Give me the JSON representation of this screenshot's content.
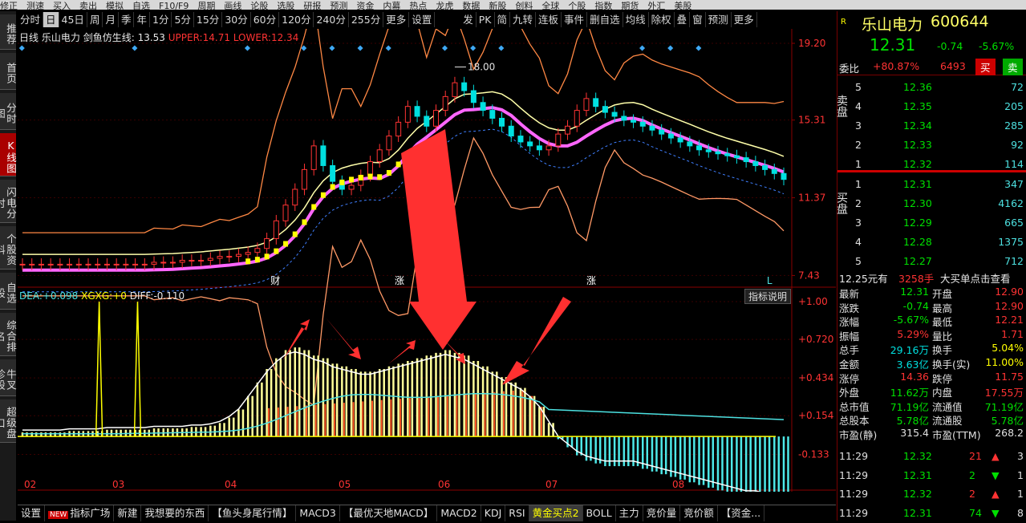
{
  "top_menu": [
    "修正",
    "测速",
    "买入",
    "卖出",
    "模拟",
    "自选",
    "F10/F9",
    "周期",
    "画线",
    "论股",
    "选股",
    "研报",
    "预测",
    "资金",
    "内幕",
    "热点",
    "龙虎",
    "数据",
    "新股",
    "创料",
    "全球",
    "个股",
    "指数",
    "期货",
    "外汇",
    "美股"
  ],
  "period_bar": {
    "items": [
      "分时",
      "日",
      "45日",
      "周",
      "月",
      "季",
      "年",
      "1分",
      "5分",
      "15分",
      "30分",
      "60分",
      "120分",
      "240分",
      "255分",
      "更多",
      "设置"
    ],
    "active": "日",
    "right_items": [
      "发",
      "PK",
      "简",
      "九转",
      "连板",
      "事件",
      "删自选",
      "均线",
      "除权",
      "叠",
      "窗",
      "预测",
      "更多"
    ]
  },
  "left_nav": [
    "推荐",
    "首页",
    "分时图",
    "K线图",
    "闪电分时",
    "个股资料",
    "自选股",
    "综合排名",
    "牛叉诊股",
    "超级盘口"
  ],
  "left_nav_active": "K线图",
  "main_header": {
    "period": "日线",
    "stock": "乐山电力",
    "indicator": "剑鱼仿生线:",
    "mid": "13.53",
    "upper_label": "UPPER:",
    "upper": "14.71",
    "lower_label": "LOWER:",
    "lower": "12.34"
  },
  "price_axis": [
    "19.20",
    "15.31",
    "11.37",
    "7.43"
  ],
  "high_label": "18.00",
  "event_markers": [
    "财",
    "涨",
    "L"
  ],
  "sub_header": {
    "dea_label": "DEA:",
    "dea": "+0.098",
    "xgxg_label": "XGXG:",
    "xgxg": "+0",
    "diff_label": "DIFF:",
    "diff": "-0.110",
    "help": "指标说明"
  },
  "sub_axis": [
    "+1.00",
    "+0.720",
    "+0.434",
    "+0.154",
    "-0.133"
  ],
  "month_labels": [
    "02",
    "03",
    "04",
    "05",
    "06",
    "07",
    "08"
  ],
  "bottom_tabs": [
    "设置",
    "指标广场",
    "新建",
    "我想要的东西",
    "【鱼头身尾行情】",
    "MACD3",
    "【最优天地MACD】",
    "MACD2",
    "KDJ",
    "RSI",
    "黄金买点2",
    "BOLL",
    "主力",
    "竞价量",
    "竞价额",
    "【资金..."
  ],
  "bottom_tab_active": "黄金买点2",
  "new_badge": "NEW",
  "quote": {
    "name": "乐山电力",
    "code": "600644",
    "flag": "R",
    "price": "12.31",
    "change": "-0.74",
    "pct": "-5.67%",
    "weibi_label": "委比",
    "weibi": "+80.87%",
    "weicha": "6493",
    "sell_btn": "买",
    "buy_btn": "卖"
  },
  "asks": [
    {
      "n": "5",
      "price": "12.36",
      "vol": "72"
    },
    {
      "n": "4",
      "price": "12.35",
      "vol": "205"
    },
    {
      "n": "3",
      "price": "12.34",
      "vol": "285"
    },
    {
      "n": "2",
      "price": "12.33",
      "vol": "92"
    },
    {
      "n": "1",
      "price": "12.32",
      "vol": "114"
    }
  ],
  "bids": [
    {
      "n": "1",
      "price": "12.31",
      "vol": "347"
    },
    {
      "n": "2",
      "price": "12.30",
      "vol": "4162"
    },
    {
      "n": "3",
      "price": "12.29",
      "vol": "665"
    },
    {
      "n": "4",
      "price": "12.28",
      "vol": "1375"
    },
    {
      "n": "5",
      "price": "12.27",
      "vol": "712"
    }
  ],
  "ask_side_label": "卖盘",
  "bid_side_label": "买盘",
  "big_order": {
    "price": "12.25元有",
    "vol": "3258手",
    "text": "大买单点击查看"
  },
  "stats": [
    [
      "最新",
      "12.31",
      "开盘",
      "12.90"
    ],
    [
      "涨跌",
      "-0.74",
      "最高",
      "12.90"
    ],
    [
      "涨幅",
      "-5.67%",
      "最低",
      "12.21"
    ],
    [
      "振幅",
      "5.29%",
      "量比",
      "1.71"
    ],
    [
      "总手",
      "29.16万",
      "换手",
      "5.04%"
    ],
    [
      "金额",
      "3.63亿",
      "换手(实)",
      "11.00%"
    ],
    [
      "涨停",
      "14.36",
      "跌停",
      "11.75"
    ],
    [
      "外盘",
      "11.62万",
      "内盘",
      "17.55万"
    ],
    [
      "总市值",
      "71.19亿",
      "流通值",
      "71.19亿"
    ],
    [
      "总股本",
      "5.78亿",
      "流通股",
      "5.78亿"
    ],
    [
      "市盈(静)",
      "315.4",
      "市盈(TTM)",
      "268.2"
    ]
  ],
  "ticks": [
    {
      "time": "11:29",
      "price": "12.32",
      "vol": "21",
      "dir": "up",
      "n": "3"
    },
    {
      "time": "11:29",
      "price": "12.31",
      "vol": "2",
      "dir": "down",
      "n": "1"
    },
    {
      "time": "11:29",
      "price": "12.32",
      "vol": "2",
      "dir": "up",
      "n": "1"
    },
    {
      "time": "11:29",
      "price": "12.31",
      "vol": "74",
      "dir": "down",
      "n": "8"
    }
  ],
  "chart_data": {
    "type": "line",
    "candle_close": [
      8.0,
      8.0,
      8.0,
      8.0,
      8.0,
      8.0,
      8.0,
      8.0,
      8.0,
      8.0,
      8.0,
      8.0,
      8.0,
      8.0,
      8.1,
      8.1,
      8.1,
      8.2,
      8.2,
      8.2,
      8.3,
      8.4,
      8.4,
      8.5,
      8.6,
      8.8,
      9.3,
      10.2,
      11.0,
      11.8,
      12.8,
      14.0,
      13.0,
      12.2,
      11.8,
      12.0,
      12.5,
      13.2,
      13.8,
      14.5,
      15.2,
      16.0,
      15.5,
      15.0,
      15.8,
      16.5,
      17.2,
      16.8,
      16.2,
      15.8,
      15.4,
      15.0,
      14.5,
      14.2,
      14.0,
      13.8,
      14.0,
      14.6,
      15.0,
      15.8,
      16.4,
      16.0,
      15.7,
      15.5,
      15.3,
      15.2,
      15.0,
      14.8,
      14.6,
      14.4,
      14.2,
      14.0,
      13.8,
      13.7,
      13.6,
      13.5,
      13.4,
      13.2,
      13.0,
      12.8,
      12.6,
      12.3
    ],
    "macd_bar": [
      0.03,
      0.03,
      0.03,
      0.03,
      0.03,
      0.04,
      0.04,
      0.04,
      0.04,
      0.05,
      0.05,
      0.05,
      0.05,
      0.05,
      0.06,
      0.06,
      0.06,
      0.06,
      0.07,
      0.07,
      0.08,
      0.1,
      0.14,
      0.2,
      0.3,
      0.4,
      0.5,
      0.58,
      0.64,
      0.66,
      0.64,
      0.6,
      0.58,
      0.54,
      0.52,
      0.5,
      0.48,
      0.48,
      0.5,
      0.52,
      0.54,
      0.56,
      0.58,
      0.6,
      0.62,
      0.64,
      0.62,
      0.6,
      0.56,
      0.52,
      0.48,
      0.44,
      0.4,
      0.36,
      0.3,
      0.22,
      0.1,
      -0.02,
      -0.08,
      -0.14,
      -0.18,
      -0.2,
      -0.22,
      -0.22,
      -0.22,
      -0.22,
      -0.24,
      -0.26,
      -0.28,
      -0.3,
      -0.32,
      -0.34,
      -0.36,
      -0.38,
      -0.4,
      -0.42,
      -0.44,
      -0.46,
      -0.46,
      -0.48,
      -0.48,
      -0.5
    ],
    "xgxg_spikes": [
      1.0,
      1.0
    ],
    "y_range_price": [
      7.0,
      19.2
    ],
    "y_range_macd": [
      -0.38,
      1.0
    ]
  }
}
